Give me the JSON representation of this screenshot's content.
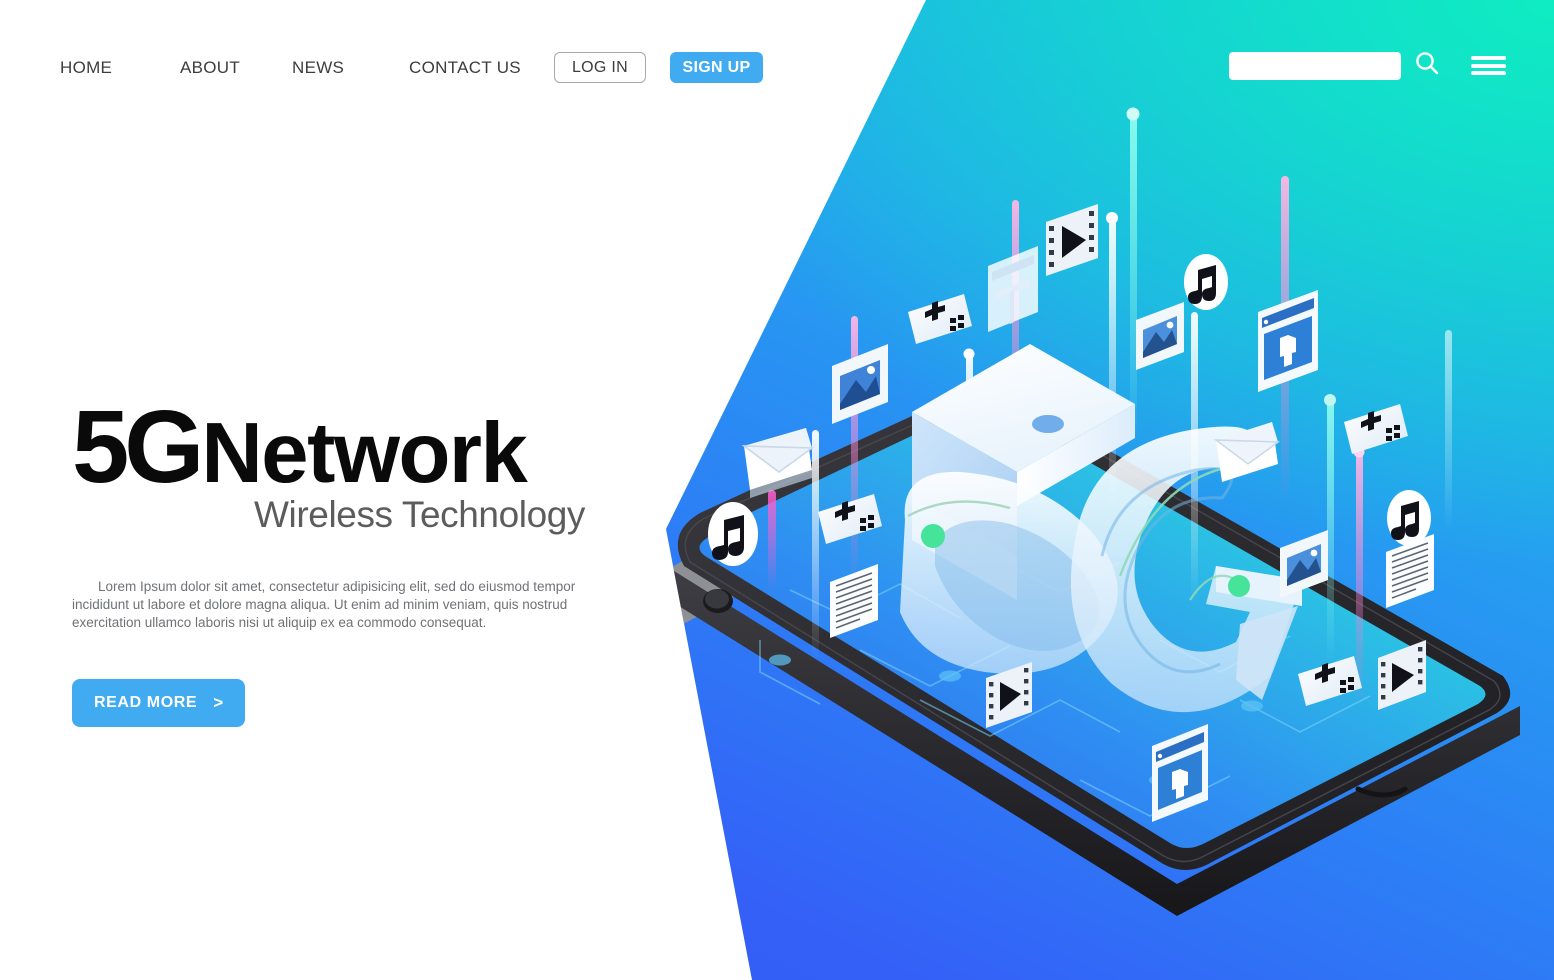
{
  "nav": {
    "links": [
      {
        "label": "HOME",
        "name": "nav-link-home"
      },
      {
        "label": "ABOUT",
        "name": "nav-link-about"
      },
      {
        "label": "NEWS",
        "name": "nav-link-news"
      },
      {
        "label": "CONTACT US",
        "name": "nav-link-contact-us"
      }
    ],
    "login_label": "LOG IN",
    "signup_label": "SIGN UP",
    "search": {
      "value": "",
      "placeholder": ""
    },
    "icons": {
      "search": "search-icon",
      "menu": "hamburger-menu-icon"
    }
  },
  "hero": {
    "title_primary": "5G",
    "title_secondary": "Network",
    "subtitle": "Wireless Technology",
    "paragraph": "Lorem Ipsum dolor sit amet, consectetur adipisicing elit, sed do eiusmod tempor incididunt ut labore et dolore magna aliqua. Ut enim ad minim veniam, quis nostrud exercitation ullamco laboris nisi ut aliquip ex ea commodo consequat.",
    "cta_label": "READ MORE",
    "cta_arrow": ">"
  },
  "illustration": {
    "device": "tablet",
    "center_text": "5G",
    "floating_icons": [
      "music-note-icon",
      "envelope-mail-icon",
      "image-photo-icon",
      "game-controller-icon",
      "document-text-icon",
      "film-video-icon",
      "browser-window-icon",
      "shopping-shirt-icon"
    ]
  },
  "colors": {
    "accent_blue": "#41abf2",
    "bg_teal": "#0fecc2",
    "bg_cyan": "#17c3dd",
    "bg_blue": "#3459f6",
    "text_dark": "#0a0a0a",
    "text_gray": "#5c5c5c",
    "body_gray": "#6f7276",
    "device_bezel": "#2e2e33",
    "screen_teal": "#16d2c2",
    "screen_blue": "#2f5ff0"
  }
}
